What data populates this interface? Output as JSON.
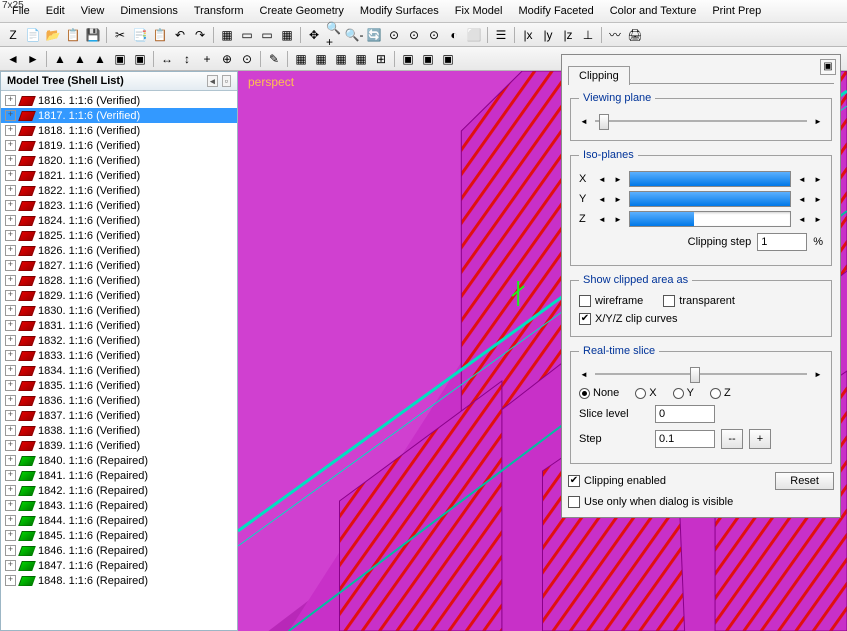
{
  "corner_text": "7x25",
  "menu": [
    "File",
    "Edit",
    "View",
    "Dimensions",
    "Transform",
    "Create Geometry",
    "Modify Surfaces",
    "Fix Model",
    "Modify Faceted",
    "Color and Texture",
    "Print Prep"
  ],
  "toolbar1": [
    "Z",
    "📄",
    "📂",
    "📋",
    "💾",
    "",
    "✂",
    "📑",
    "📋",
    "↶",
    "↷",
    "",
    "▦",
    "▭",
    "▭",
    "▦",
    "",
    "✥",
    "🔍+",
    "🔍-",
    "🔄",
    "⊙",
    "⊙",
    "⊙",
    "◐",
    "⬜",
    "",
    "☰",
    "",
    "|x",
    "|y",
    "|z",
    "⊥",
    "",
    "〰",
    "🖨"
  ],
  "toolbar2": [
    "◄",
    "►",
    "",
    "▲",
    "▲",
    "▲",
    "▣",
    "▣",
    "",
    "↔",
    "↕",
    "+",
    "⊕",
    "⊙",
    "",
    "✎",
    "",
    "▦",
    "▦",
    "▦",
    "▦",
    "⊞",
    "",
    "▣",
    "▣",
    "▣"
  ],
  "tree": {
    "title": "Model Tree (Shell List)",
    "items": [
      {
        "id": 1816,
        "status": "Verified",
        "c": "red"
      },
      {
        "id": 1817,
        "status": "Verified",
        "c": "red",
        "sel": true
      },
      {
        "id": 1818,
        "status": "Verified",
        "c": "red"
      },
      {
        "id": 1819,
        "status": "Verified",
        "c": "red"
      },
      {
        "id": 1820,
        "status": "Verified",
        "c": "red"
      },
      {
        "id": 1821,
        "status": "Verified",
        "c": "red"
      },
      {
        "id": 1822,
        "status": "Verified",
        "c": "red"
      },
      {
        "id": 1823,
        "status": "Verified",
        "c": "red"
      },
      {
        "id": 1824,
        "status": "Verified",
        "c": "red"
      },
      {
        "id": 1825,
        "status": "Verified",
        "c": "red"
      },
      {
        "id": 1826,
        "status": "Verified",
        "c": "red"
      },
      {
        "id": 1827,
        "status": "Verified",
        "c": "red"
      },
      {
        "id": 1828,
        "status": "Verified",
        "c": "red"
      },
      {
        "id": 1829,
        "status": "Verified",
        "c": "red"
      },
      {
        "id": 1830,
        "status": "Verified",
        "c": "red"
      },
      {
        "id": 1831,
        "status": "Verified",
        "c": "red"
      },
      {
        "id": 1832,
        "status": "Verified",
        "c": "red"
      },
      {
        "id": 1833,
        "status": "Verified",
        "c": "red"
      },
      {
        "id": 1834,
        "status": "Verified",
        "c": "red"
      },
      {
        "id": 1835,
        "status": "Verified",
        "c": "red"
      },
      {
        "id": 1836,
        "status": "Verified",
        "c": "red"
      },
      {
        "id": 1837,
        "status": "Verified",
        "c": "red"
      },
      {
        "id": 1838,
        "status": "Verified",
        "c": "red"
      },
      {
        "id": 1839,
        "status": "Verified",
        "c": "red"
      },
      {
        "id": 1840,
        "status": "Repaired",
        "c": "green"
      },
      {
        "id": 1841,
        "status": "Repaired",
        "c": "green"
      },
      {
        "id": 1842,
        "status": "Repaired",
        "c": "green"
      },
      {
        "id": 1843,
        "status": "Repaired",
        "c": "green"
      },
      {
        "id": 1844,
        "status": "Repaired",
        "c": "green"
      },
      {
        "id": 1845,
        "status": "Repaired",
        "c": "green"
      },
      {
        "id": 1846,
        "status": "Repaired",
        "c": "green"
      },
      {
        "id": 1847,
        "status": "Repaired",
        "c": "green"
      },
      {
        "id": 1848,
        "status": "Repaired",
        "c": "green"
      }
    ]
  },
  "viewport": {
    "label": "perspect"
  },
  "panel": {
    "tab": "Clipping",
    "viewing_plane": {
      "legend": "Viewing plane"
    },
    "iso": {
      "legend": "Iso-planes",
      "axes": [
        "X",
        "Y",
        "Z"
      ],
      "fill_pct": [
        100,
        100,
        40
      ]
    },
    "clipping_step": {
      "label": "Clipping step",
      "value": "1",
      "unit": "%"
    },
    "clipped_area": {
      "legend": "Show clipped area as",
      "wireframe": {
        "label": "wireframe",
        "checked": false
      },
      "transparent": {
        "label": "transparent",
        "checked": false
      },
      "curves": {
        "label": "X/Y/Z clip curves",
        "checked": true
      }
    },
    "slice": {
      "legend": "Real-time slice",
      "options": [
        "None",
        "X",
        "Y",
        "Z"
      ],
      "selected": "None",
      "level_label": "Slice level",
      "level_value": "0",
      "step_label": "Step",
      "step_value": "0.1",
      "minus": "--",
      "plus": "+"
    },
    "enabled": {
      "label": "Clipping enabled",
      "checked": true
    },
    "reset": "Reset",
    "use_only": {
      "label": "Use only when dialog is visible",
      "checked": false
    }
  }
}
